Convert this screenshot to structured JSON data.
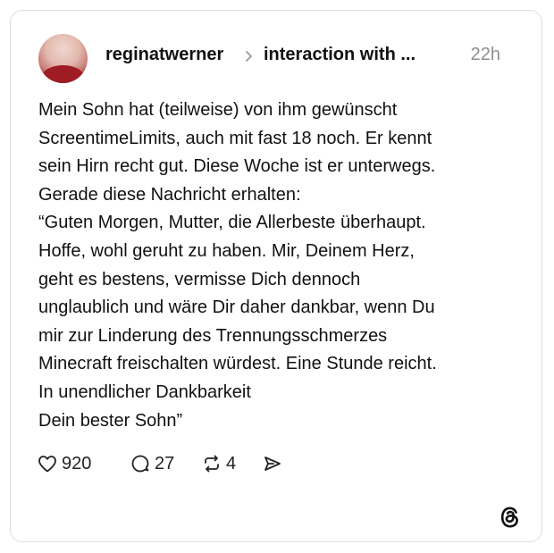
{
  "post": {
    "username": "reginatwerner",
    "thread_title": "interaction with ...",
    "timestamp": "22h",
    "text": "Mein Sohn hat (teilweise) von ihm gewünscht\nScreentimeLimits, auch mit fast 18 noch. Er kennt\nsein Hirn recht gut. Diese Woche ist er unterwegs.\nGerade diese Nachricht erhalten:\n“Guten Morgen, Mutter, die Allerbeste überhaupt.\nHoffe, wohl geruht zu haben. Mir, Deinem Herz,\ngeht es bestens, vermisse Dich dennoch\nunglaublich und wäre Dir daher dankbar, wenn Du\nmir zur Linderung des Trennungsschmerzes\nMinecraft freischalten würdest. Eine Stunde reicht.\nIn unendlicher Dankbarkeit\nDein bester Sohn”"
  },
  "actions": {
    "likes": "920",
    "replies": "27",
    "reposts": "4"
  },
  "icons": {
    "like": "heart-icon",
    "reply": "comment-icon",
    "repost": "repost-icon",
    "share": "send-icon",
    "brand": "threads-logo-icon",
    "separator": "chevron-right-icon"
  }
}
